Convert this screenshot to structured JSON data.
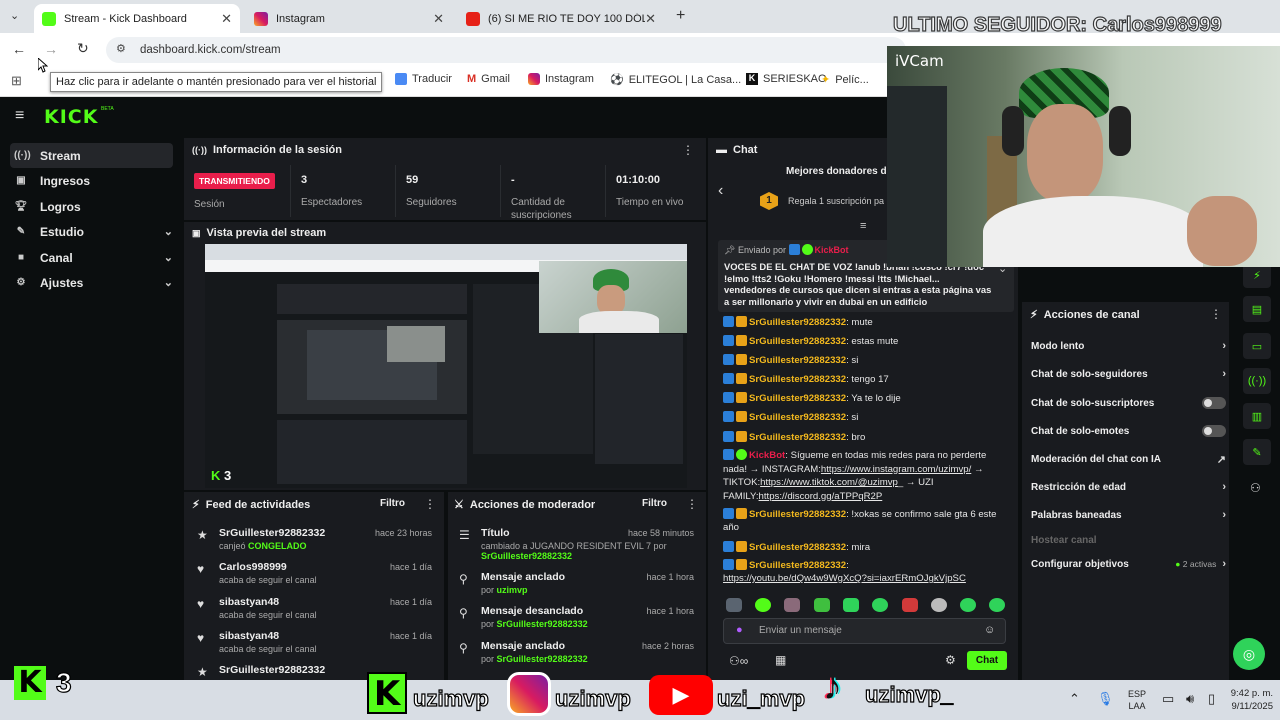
{
  "browser": {
    "tabs": [
      {
        "label": "Stream - Kick Dashboard",
        "active": true
      },
      {
        "label": "Instagram",
        "active": false
      },
      {
        "label": "(6) SI ME RIO TE DOY 100 DÓLA",
        "active": false
      }
    ],
    "url": "dashboard.kick.com/stream",
    "tooltip": "Haz clic para ir adelante o mantén presionado para ver el historial",
    "bookmarks": [
      "Traducir",
      "Gmail",
      "Instagram",
      "ELITEGOL | La Casa...",
      "SERIESKAO",
      "Pelíc..."
    ]
  },
  "overlay": {
    "last_follower": "ULTIMO SEGUIDOR: Carlos998999",
    "cam_label": "iVCam",
    "bottom_counter": "3",
    "socials": [
      "uzimvp",
      "uzimvp",
      "uzi_mvp",
      "uzimvp_"
    ]
  },
  "sidebar": {
    "items": [
      {
        "label": "Stream",
        "icon": "stream-icon",
        "chev": ""
      },
      {
        "label": "Ingresos",
        "icon": "wallet-icon",
        "chev": ""
      },
      {
        "label": "Logros",
        "icon": "trophy-icon",
        "chev": ""
      },
      {
        "label": "Estudio",
        "icon": "studio-icon",
        "chev": "⌄"
      },
      {
        "label": "Canal",
        "icon": "channel-icon",
        "chev": "⌄"
      },
      {
        "label": "Ajustes",
        "icon": "gear-icon",
        "chev": "⌄"
      }
    ]
  },
  "session": {
    "title": "Información de la sesión",
    "status": "TRANSMITIENDO",
    "status_label": "Sesión",
    "stats": [
      {
        "value": "3",
        "label": "Espectadores"
      },
      {
        "value": "59",
        "label": "Seguidores"
      },
      {
        "value": "-",
        "label": "Cantidad de suscripciones"
      },
      {
        "value": "01:10:00",
        "label": "Tiempo en vivo"
      }
    ]
  },
  "preview": {
    "title": "Vista previa del stream",
    "viewers": "3"
  },
  "feed": {
    "title": "Feed de actividades",
    "filter": "Filtro",
    "items": [
      {
        "name": "SrGuillester92882332",
        "sub_prefix": "canjeó ",
        "sub_highlight": "CONGELADO",
        "time": "hace 23 horas",
        "icon": "★"
      },
      {
        "name": "Carlos998999",
        "sub_prefix": "acaba de seguir el canal",
        "sub_highlight": "",
        "time": "hace 1 día",
        "icon": "♥"
      },
      {
        "name": "sibastyan48",
        "sub_prefix": "acaba de seguir el canal",
        "sub_highlight": "",
        "time": "hace 1 día",
        "icon": "♥"
      },
      {
        "name": "sibastyan48",
        "sub_prefix": "acaba de seguir el canal",
        "sub_highlight": "",
        "time": "hace 1 día",
        "icon": "♥"
      },
      {
        "name": "SrGuillester92882332",
        "sub_prefix": "",
        "sub_highlight": "",
        "time": "",
        "icon": "★"
      }
    ]
  },
  "mod": {
    "title": "Acciones de moderador",
    "filter": "Filtro",
    "items": [
      {
        "name": "Título",
        "sub": "cambiado a JUGANDO RESIDENT EVIL 7 por",
        "who": "SrGuillester92882332",
        "time": "hace 58 minutos",
        "icon": "☰"
      },
      {
        "name": "Mensaje anclado",
        "sub": "por",
        "who": "uzimvp",
        "time": "hace 1 hora",
        "icon": "⚲"
      },
      {
        "name": "Mensaje desanclado",
        "sub": "por",
        "who": "SrGuillester92882332",
        "time": "hace 1 hora",
        "icon": "⚲"
      },
      {
        "name": "Mensaje anclado",
        "sub": "por",
        "who": "SrGuillester92882332",
        "time": "hace 2 horas",
        "icon": "⚲"
      }
    ]
  },
  "chat": {
    "title": "Chat",
    "donors_title": "Mejores donadores d",
    "donor_rank": "1",
    "donor_text": "Regala 1 suscripción pa",
    "pinned_label": "Enviado por",
    "pinned_author": "KickBot",
    "pinned_text": "VOCES DE EL CHAT DE VOZ !anub !brian !cosco !cr7 !doc !elmo !tts2 !Goku !Homero !messi !tts !Michael... vendedores de cursos que dicen si entras a esta página vas a ser millonario y vivir en dubai en un edificio",
    "messages": [
      {
        "user": "SrGuillester92882332",
        "text": ": mute"
      },
      {
        "user": "SrGuillester92882332",
        "text": ": estas mute"
      },
      {
        "user": "SrGuillester92882332",
        "text": ": si"
      },
      {
        "user": "SrGuillester92882332",
        "text": ": tengo 17"
      },
      {
        "user": "SrGuillester92882332",
        "text": ": Ya te lo dije"
      },
      {
        "user": "SrGuillester92882332",
        "text": ": si"
      },
      {
        "user": "SrGuillester92882332",
        "text": ": bro"
      }
    ],
    "bot_user": "KickBot",
    "bot_text": ": Sígueme en todas mis redes para no perderte nada! → INSTAGRAM:",
    "bot_link1": "https://www.instagram.com/uzimvp/",
    "bot_mid": " → TIKTOK:",
    "bot_link2": "https://www.tiktok.com/@uzimvp",
    "bot_mid2": "_ → UZI FAMILY:",
    "bot_link3": "https://discord.gg/aTPPqR2P",
    "late_messages": [
      {
        "user": "SrGuillester92882332",
        "text": ": !xokas se confirmo sale gta 6 este año"
      },
      {
        "user": "SrGuillester92882332",
        "text": ": mira"
      },
      {
        "user": "SrGuillester92882332",
        "text": ":"
      }
    ],
    "yt_link": "https://youtu.be/dQw4w9WgXcQ?si=iaxrERmOJgkVjpSC",
    "input_placeholder": "Enviar un mensaje",
    "send": "Chat"
  },
  "actions": {
    "title": "Acciones de canal",
    "items": [
      {
        "label": "Modo lento",
        "kind": "arrow"
      },
      {
        "label": "Chat de solo-seguidores",
        "kind": "arrow"
      },
      {
        "label": "Chat de solo-suscriptores",
        "kind": "toggle"
      },
      {
        "label": "Chat de solo-emotes",
        "kind": "toggle"
      },
      {
        "label": "Moderación del chat con IA",
        "kind": "ext"
      },
      {
        "label": "Restricción de edad",
        "kind": "arrow"
      },
      {
        "label": "Palabras baneadas",
        "kind": "arrow"
      },
      {
        "label": "Hostear canal",
        "kind": "disabled"
      },
      {
        "label": "Configurar objetivos",
        "kind": "goal",
        "extra": "2 activas"
      }
    ]
  },
  "taskbar": {
    "lang1": "ESP",
    "lang2": "LAA",
    "time": "9:42 p. m.",
    "date": "9/11/2025"
  },
  "colors": {
    "kick_green": "#53fc18",
    "live_red": "#e91e4b",
    "username": "#f2b81e"
  }
}
